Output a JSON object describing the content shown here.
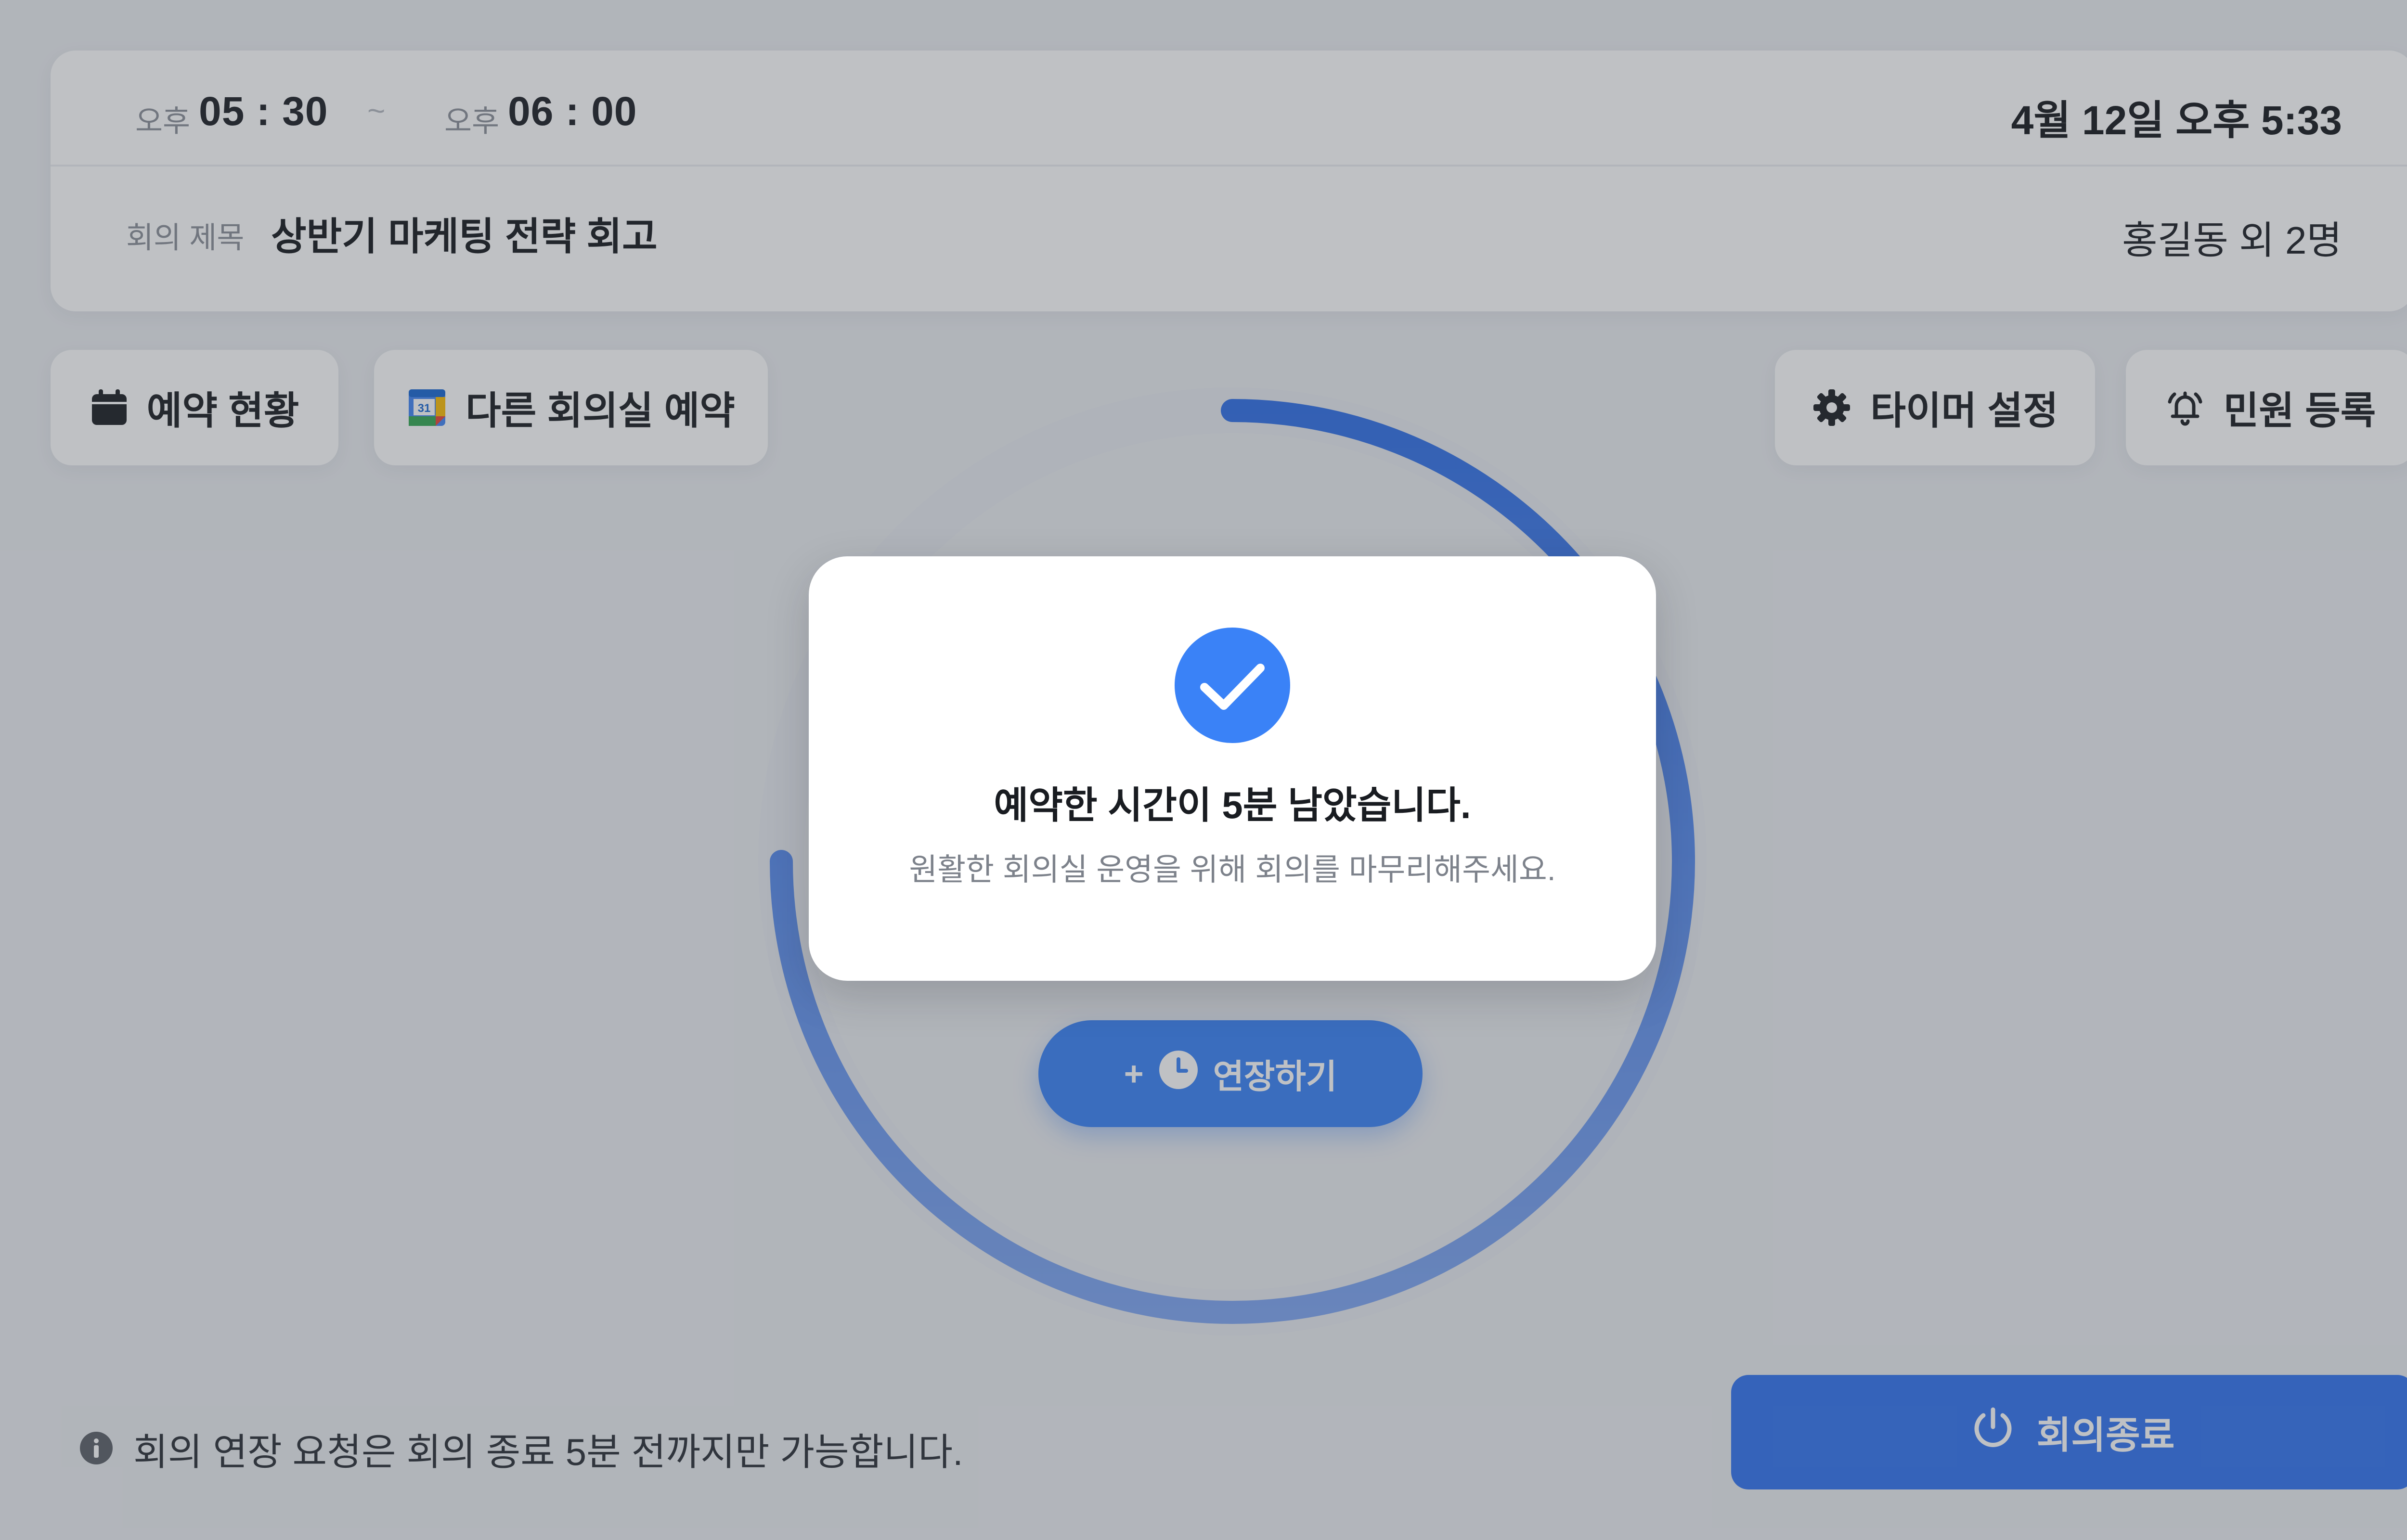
{
  "header": {
    "start": {
      "ampm": "오후",
      "time": "05 : 30"
    },
    "separator": "~",
    "end": {
      "ampm": "오후",
      "time": "06 : 00"
    },
    "now": "4월 12일 오후 5:33",
    "title_label": "회의 제목",
    "title": "상반기 마케팅 전략 회고",
    "participants": "홍길동 외 2명"
  },
  "actions": {
    "reservation_status": {
      "label": "예약 현황",
      "icon": "calendar-icon"
    },
    "book_other_room": {
      "label": "다른 회의실 예약",
      "icon": "google-calendar-icon",
      "icon_text": "31"
    },
    "timer_settings": {
      "label": "타이머 설정",
      "icon": "gear-icon"
    },
    "complaint": {
      "label": "민원 등록",
      "icon": "bell-icon"
    }
  },
  "timer": {
    "remaining_fraction": 0.75,
    "progress_color": "#2f6fe8",
    "track_color": "#e4e7ee"
  },
  "extend_button": {
    "plus": "+",
    "label": "연장하기",
    "icon": "clock-icon"
  },
  "notice": {
    "icon": "info-icon",
    "text": "회의 연장 요청은 회의 종료 5분 전까지만 가능합니다."
  },
  "end_button": {
    "label": "회의종료",
    "icon": "power-icon"
  },
  "modal": {
    "icon": "check-circle-icon",
    "title": "예약한 시간이 5분 남았습니다.",
    "message": "원활한 회의실 운영을 위해 회의를 마무리해주세요."
  },
  "colors": {
    "accent": "#3a82f7",
    "end_button": "#3274f0",
    "background": "#ebedf1"
  }
}
